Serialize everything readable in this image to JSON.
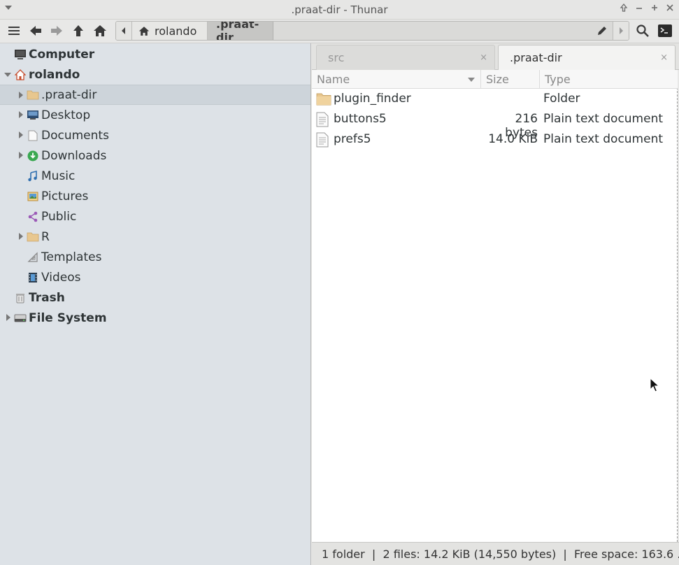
{
  "window": {
    "title": ".praat-dir - Thunar"
  },
  "pathbar": {
    "home_label": "rolando",
    "current_label": ".praat-dir"
  },
  "sidebar": {
    "items": [
      {
        "label": "Computer",
        "icon": "computer-icon",
        "bold": true
      },
      {
        "label": "rolando",
        "icon": "home-icon",
        "bold": true
      },
      {
        "label": ".praat-dir",
        "icon": "folder-icon"
      },
      {
        "label": "Desktop",
        "icon": "desktop-icon"
      },
      {
        "label": "Documents",
        "icon": "document-icon"
      },
      {
        "label": "Downloads",
        "icon": "download-icon"
      },
      {
        "label": "Music",
        "icon": "music-icon"
      },
      {
        "label": "Pictures",
        "icon": "pictures-icon"
      },
      {
        "label": "Public",
        "icon": "share-icon"
      },
      {
        "label": "R",
        "icon": "folder-icon"
      },
      {
        "label": "Templates",
        "icon": "template-icon"
      },
      {
        "label": "Videos",
        "icon": "video-icon"
      },
      {
        "label": "Trash",
        "icon": "trash-icon",
        "bold": true
      },
      {
        "label": "File System",
        "icon": "drive-icon",
        "bold": true
      }
    ]
  },
  "tabs": [
    {
      "label": "src",
      "close": "×"
    },
    {
      "label": ".praat-dir",
      "close": "×"
    }
  ],
  "columns": {
    "name": "Name",
    "size": "Size",
    "type": "Type"
  },
  "files": [
    {
      "name": "plugin_finder",
      "size": "",
      "type": "Folder",
      "icon": "folder-icon"
    },
    {
      "name": "buttons5",
      "size": "216 bytes",
      "type": "Plain text document",
      "icon": "text-file-icon"
    },
    {
      "name": "prefs5",
      "size": "14.0 KiB",
      "type": "Plain text document",
      "icon": "text-file-icon"
    }
  ],
  "status": {
    "text": "1 folder  |  2 files: 14.2 KiB (14,550 bytes)  |  Free space: 163.6 ..."
  },
  "colors": {
    "sidebar_bg": "#dde2e7",
    "selected_bg": "#cdd4da",
    "folder": "#e8c78f"
  }
}
